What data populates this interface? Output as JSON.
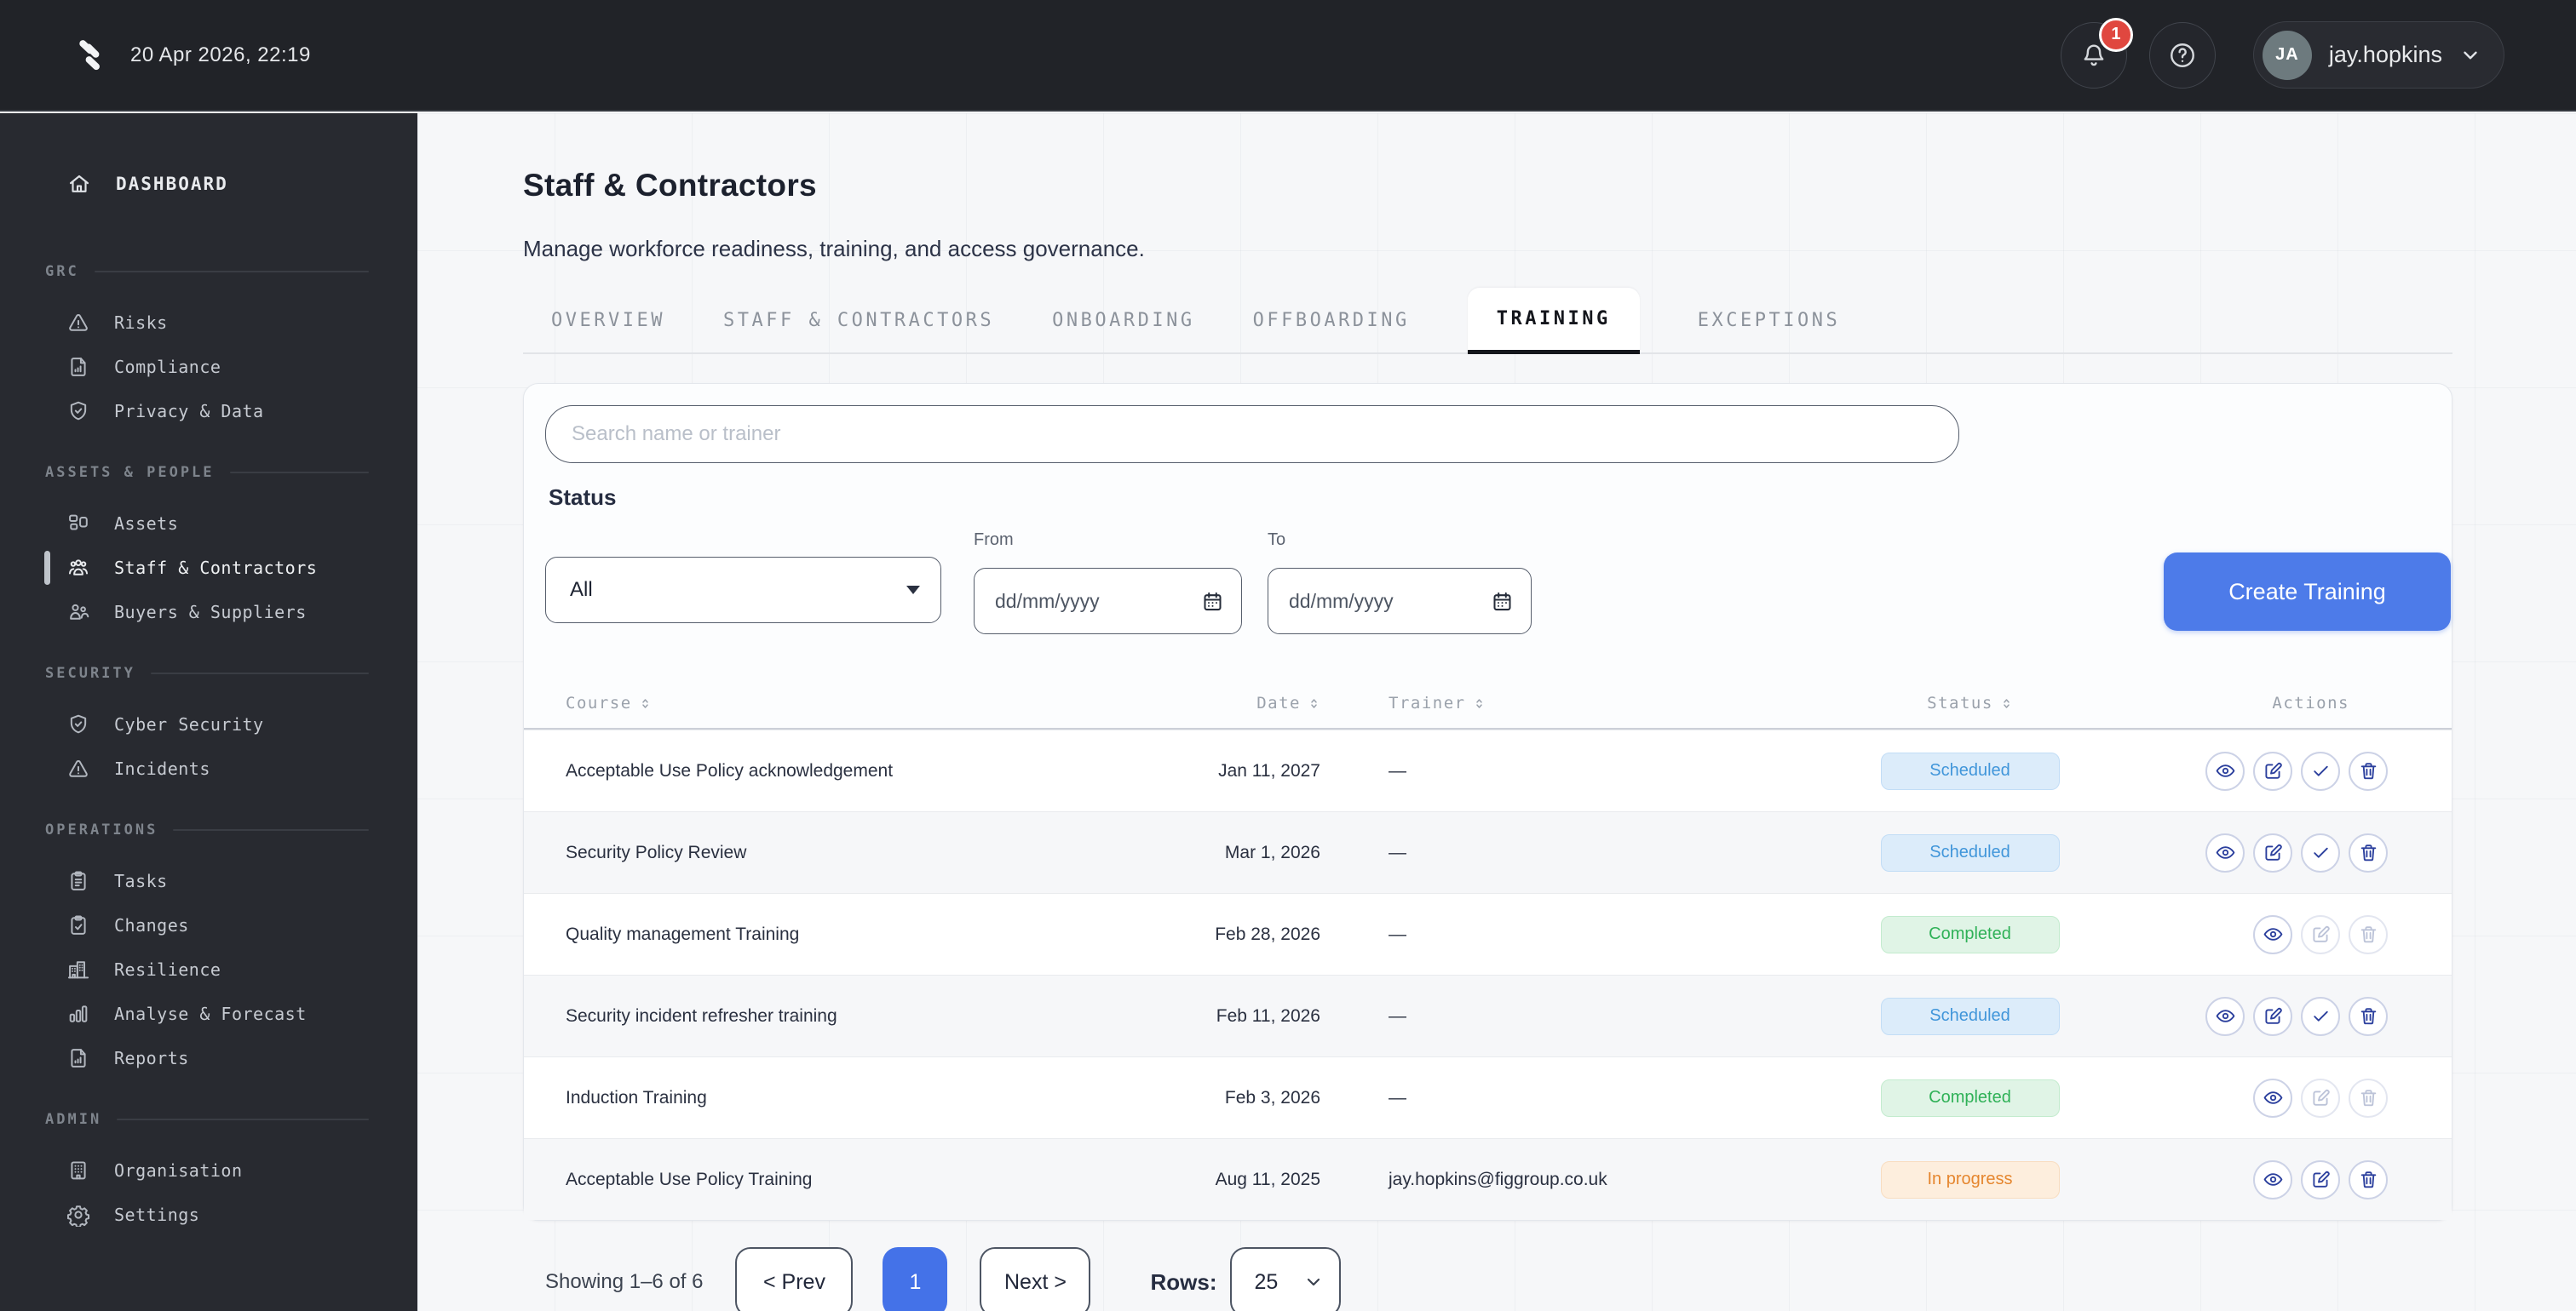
{
  "topbar": {
    "datetime": "20 Apr 2026, 22:19",
    "notification_count": "1",
    "user": {
      "initials": "JA",
      "name": "jay.hopkins"
    }
  },
  "sidebar": {
    "dashboard": "DASHBOARD",
    "active_item": "Staff & Contractors",
    "sections": [
      {
        "title": "GRC",
        "items": [
          "Risks",
          "Compliance",
          "Privacy & Data"
        ]
      },
      {
        "title": "ASSETS & PEOPLE",
        "items": [
          "Assets",
          "Staff & Contractors",
          "Buyers & Suppliers"
        ]
      },
      {
        "title": "SECURITY",
        "items": [
          "Cyber Security",
          "Incidents"
        ]
      },
      {
        "title": "OPERATIONS",
        "items": [
          "Tasks",
          "Changes",
          "Resilience",
          "Analyse & Forecast",
          "Reports"
        ]
      },
      {
        "title": "ADMIN",
        "items": [
          "Organisation",
          "Settings"
        ]
      }
    ]
  },
  "page": {
    "title": "Staff & Contractors",
    "subtitle": "Manage workforce readiness, training, and access governance.",
    "tabs": [
      "OVERVIEW",
      "STAFF & CONTRACTORS",
      "ONBOARDING",
      "OFFBOARDING",
      "TRAINING",
      "EXCEPTIONS"
    ],
    "active_tab": "TRAINING"
  },
  "filters": {
    "search_placeholder": "Search name or trainer",
    "status_label": "Status",
    "status_value": "All",
    "from_label": "From",
    "to_label": "To",
    "date_placeholder": "dd/mm/yyyy",
    "create_button": "Create Training"
  },
  "table": {
    "headers": {
      "course": "Course",
      "date": "Date",
      "trainer": "Trainer",
      "status": "Status",
      "actions": "Actions"
    },
    "rows": [
      {
        "course": "Acceptable Use Policy acknowledgement",
        "date": "Jan 11, 2027",
        "trainer": "—",
        "status": "Scheduled",
        "actions": [
          "view",
          "edit",
          "complete",
          "delete"
        ]
      },
      {
        "course": "Security Policy Review",
        "date": "Mar 1, 2026",
        "trainer": "—",
        "status": "Scheduled",
        "actions": [
          "view",
          "edit",
          "complete",
          "delete"
        ]
      },
      {
        "course": "Quality management Training",
        "date": "Feb 28, 2026",
        "trainer": "—",
        "status": "Completed",
        "actions": [
          "view"
        ]
      },
      {
        "course": "Security incident refresher training",
        "date": "Feb 11, 2026",
        "trainer": "—",
        "status": "Scheduled",
        "actions": [
          "view",
          "edit",
          "complete",
          "delete"
        ]
      },
      {
        "course": "Induction Training",
        "date": "Feb 3, 2026",
        "trainer": "—",
        "status": "Completed",
        "actions": [
          "view"
        ]
      },
      {
        "course": "Acceptable Use Policy Training",
        "date": "Aug 11, 2025",
        "trainer": "jay.hopkins@figgroup.co.uk",
        "status": "In progress",
        "actions": [
          "view",
          "edit",
          "delete"
        ]
      }
    ]
  },
  "pagination": {
    "summary": "Showing 1–6 of 6",
    "prev": "< Prev",
    "current_page": "1",
    "next": "Next >",
    "rows_label": "Rows:",
    "rows_value": "25"
  },
  "colors": {
    "accent_blue": "#4d7be9",
    "pagination_active_blue": "#4472e8",
    "scheduled_text": "#4196da",
    "scheduled_bg": "#dcecfa",
    "completed_text": "#2fb157",
    "completed_bg": "#e0f4e6",
    "in_progress_text": "#e5862e",
    "in_progress_bg": "#fdeedd",
    "action_icon_navy": "#2b3f9d",
    "notification_red": "#e0473f"
  }
}
